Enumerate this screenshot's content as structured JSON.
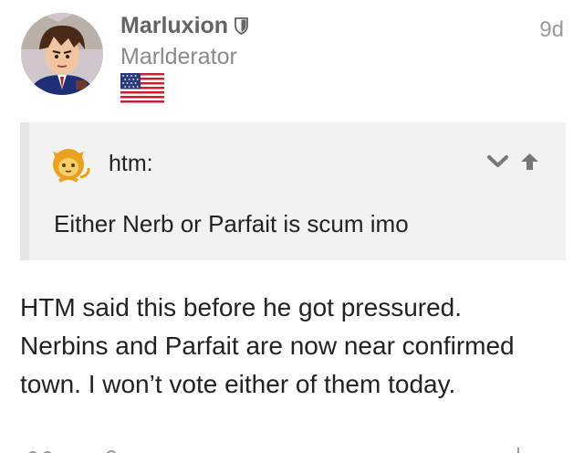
{
  "post": {
    "username": "Marluxion",
    "user_title": "Marlderator",
    "time_ago": "9d",
    "body_lines": [
      "HTM said this before he got pressured.",
      "Nerbins and Parfait are now near confirmed",
      "town. I won’t vote either of them today."
    ]
  },
  "quote": {
    "username": "htm:",
    "text": "Either Nerb or Parfait is scum imo",
    "controls": {
      "collapse_icon": "chevron-down-icon",
      "jump_icon": "arrow-up-icon"
    }
  },
  "icons": {
    "moderator": "shield-icon",
    "flag": "us-flag-icon"
  },
  "colors": {
    "username": "#646464",
    "quote_background": "#f2f2f2",
    "quote_border": "#e6e6e6",
    "icon_gray": "#777777"
  }
}
